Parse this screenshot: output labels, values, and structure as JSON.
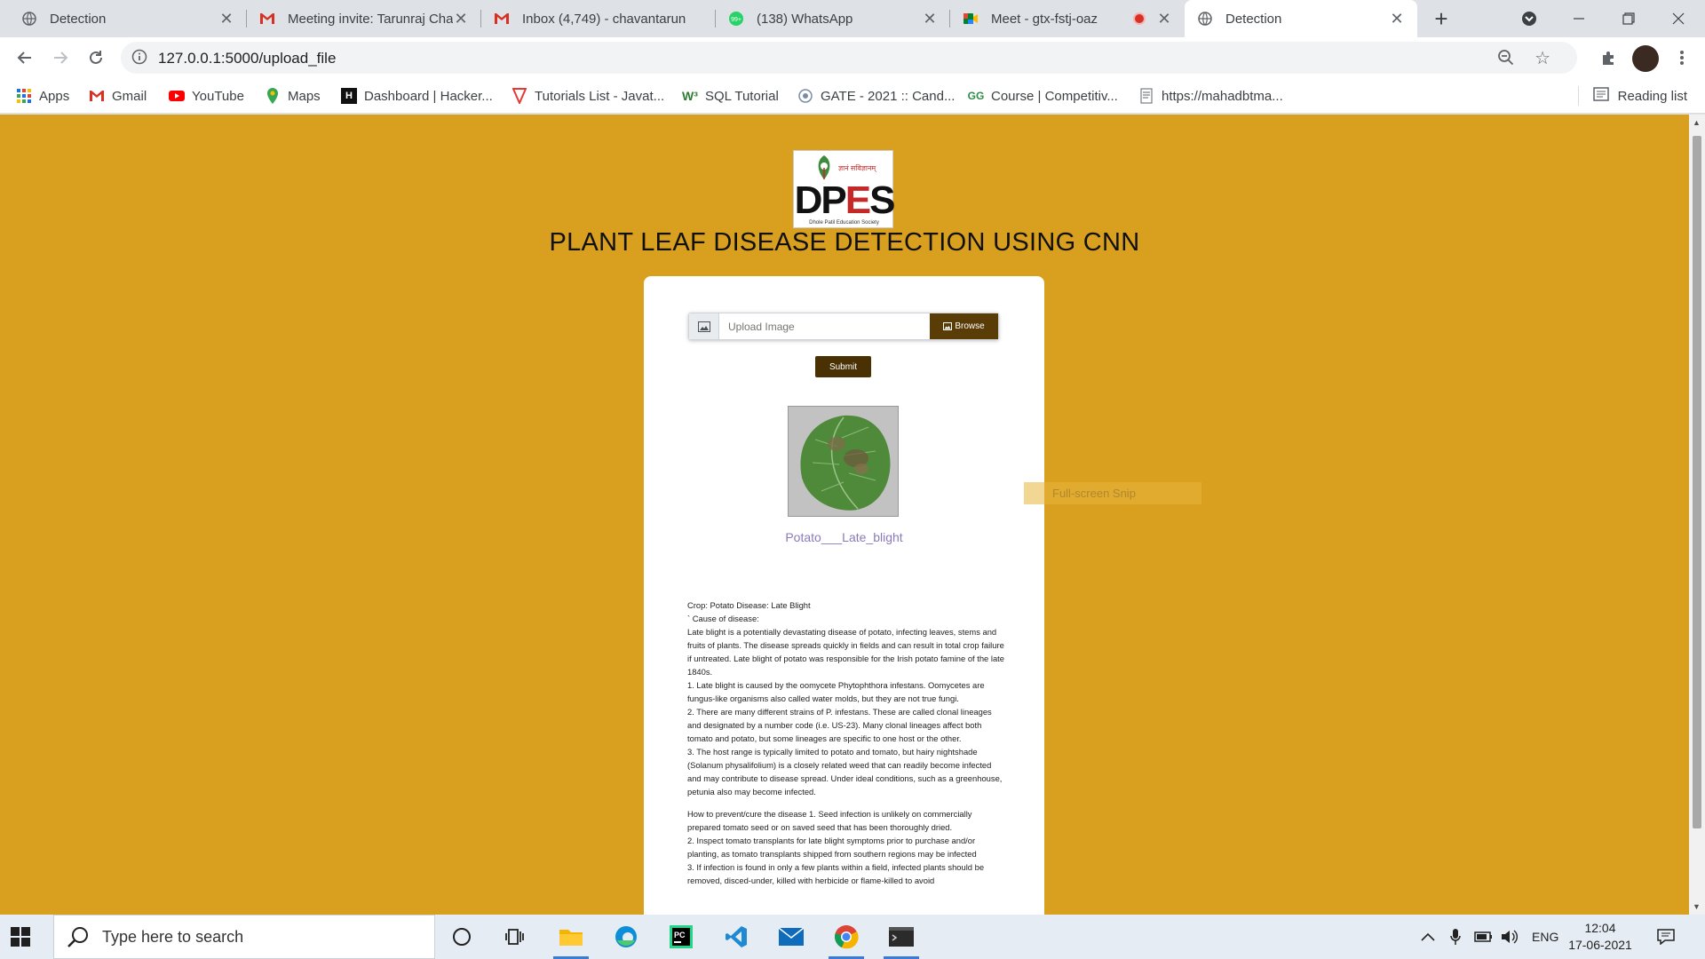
{
  "browser": {
    "tabs": [
      {
        "title": "Detection",
        "icon": "globe-icon"
      },
      {
        "title": "Meeting invite: Tarunraj Cha",
        "icon": "gmail-icon"
      },
      {
        "title": "Inbox (4,749) - chavantarun",
        "icon": "gmail-icon"
      },
      {
        "title": "(138) WhatsApp",
        "icon": "whatsapp-icon"
      },
      {
        "title": "Meet - gtx-fstj-oaz",
        "icon": "meet-icon"
      },
      {
        "title": "Detection",
        "icon": "globe-icon"
      }
    ],
    "new_tab": "+",
    "url": "127.0.0.1:5000/upload_file",
    "bookmarks": [
      {
        "label": "Apps",
        "icon": "apps-icon"
      },
      {
        "label": "Gmail",
        "icon": "gmail-icon"
      },
      {
        "label": "YouTube",
        "icon": "youtube-icon"
      },
      {
        "label": "Maps",
        "icon": "maps-icon"
      },
      {
        "label": "Dashboard | Hacker...",
        "icon": "hackerrank-icon"
      },
      {
        "label": "Tutorials List - Javat...",
        "icon": "javatpoint-icon"
      },
      {
        "label": "SQL Tutorial",
        "icon": "w3schools-icon"
      },
      {
        "label": "GATE - 2021 :: Cand...",
        "icon": "gate-icon"
      },
      {
        "label": "Course | Competitiv...",
        "icon": "gfg-icon"
      },
      {
        "label": "https://mahadbtma...",
        "icon": "page-icon"
      }
    ],
    "reading_list": "Reading list"
  },
  "page": {
    "logo": {
      "text_d": "DP",
      "text_e": "E",
      "text_s": "S",
      "subtitle": "Dhole Patil Education Society",
      "hindi": "ज्ञानं सविज्ञानम्"
    },
    "title": "PLANT LEAF DISEASE DETECTION USING CNN",
    "upload_placeholder": "Upload Image",
    "browse_label": "Browse",
    "submit_label": "Submit",
    "prediction": "Potato___Late_blight",
    "info": {
      "line1": "Crop: Potato Disease: Late Blight",
      "line2": "` Cause of disease:",
      "para1": "Late blight is a potentially devastating disease of potato, infecting leaves, stems and fruits of plants. The disease spreads quickly in fields and can result in total crop failure if untreated. Late blight of potato was responsible for the Irish potato famine of the late 1840s.",
      "p2": "1. Late blight is caused by the oomycete Phytophthora infestans. Oomycetes are fungus-like organisms also called water molds, but they are not true fungi.",
      "p3": "2. There are many different strains of P. infestans. These are called clonal lineages and designated by a number code (i.e. US-23). Many clonal lineages affect both tomato and potato, but some lineages are specific to one host or the other.",
      "p4": "3. The host range is typically limited to potato and tomato, but hairy nightshade (Solanum physalifolium) is a closely related weed that can readily become infected and may contribute to disease spread. Under ideal conditions, such as a greenhouse, petunia also may become infected.",
      "p5": "How to prevent/cure the disease 1. Seed infection is unlikely on commercially prepared tomato seed or on saved seed that has been thoroughly dried.",
      "p6": "2. Inspect tomato transplants for late blight symptoms prior to purchase and/or planting, as tomato transplants shipped from southern regions may be infected",
      "p7": "3. If infection is found in only a few plants within a field, infected plants should be removed, disced-under, killed with herbicide or flame-killed to avoid"
    },
    "snip_overlay": "Full-screen Snip"
  },
  "taskbar": {
    "search_placeholder": "Type here to search",
    "language": "ENG",
    "time": "12:04",
    "date": "17-06-2021"
  },
  "colors": {
    "page_bg": "#d99f1f",
    "button_dark": "#4a3104",
    "prediction_text": "#8b7ab8"
  }
}
